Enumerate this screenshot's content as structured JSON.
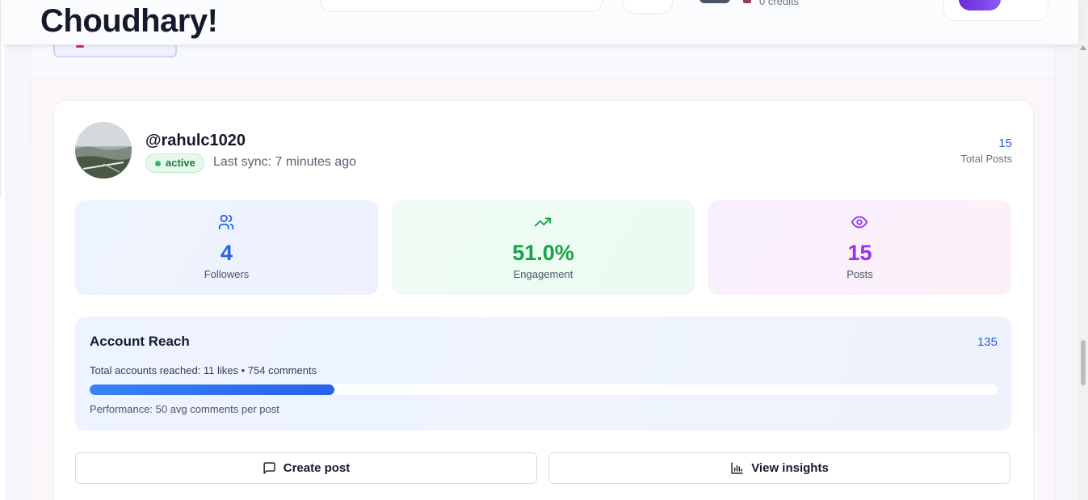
{
  "header": {
    "greeting_line": "Choudhary!",
    "credits_text": "0 credits"
  },
  "account": {
    "handle": "@rahulc1020",
    "status": "active",
    "last_sync": "Last sync: 7 minutes ago",
    "total_posts_value": "15",
    "total_posts_label": "Total Posts"
  },
  "stats": [
    {
      "value": "4",
      "label": "Followers",
      "icon": "users-icon"
    },
    {
      "value": "51.0%",
      "label": "Engagement",
      "icon": "trending-up-icon"
    },
    {
      "value": "15",
      "label": "Posts",
      "icon": "eye-icon"
    }
  ],
  "reach": {
    "title": "Account Reach",
    "value": "135",
    "subtitle": "Total accounts reached: 11 likes • 754 comments",
    "progress_fraction": 0.27,
    "performance": "Performance: 50 avg comments per post"
  },
  "actions": {
    "create_post": "Create post",
    "view_insights": "View insights"
  },
  "colors": {
    "accent_blue": "#2563eb",
    "accent_green": "#16a34a",
    "accent_purple": "#9333ea",
    "active_green": "#15803d"
  }
}
